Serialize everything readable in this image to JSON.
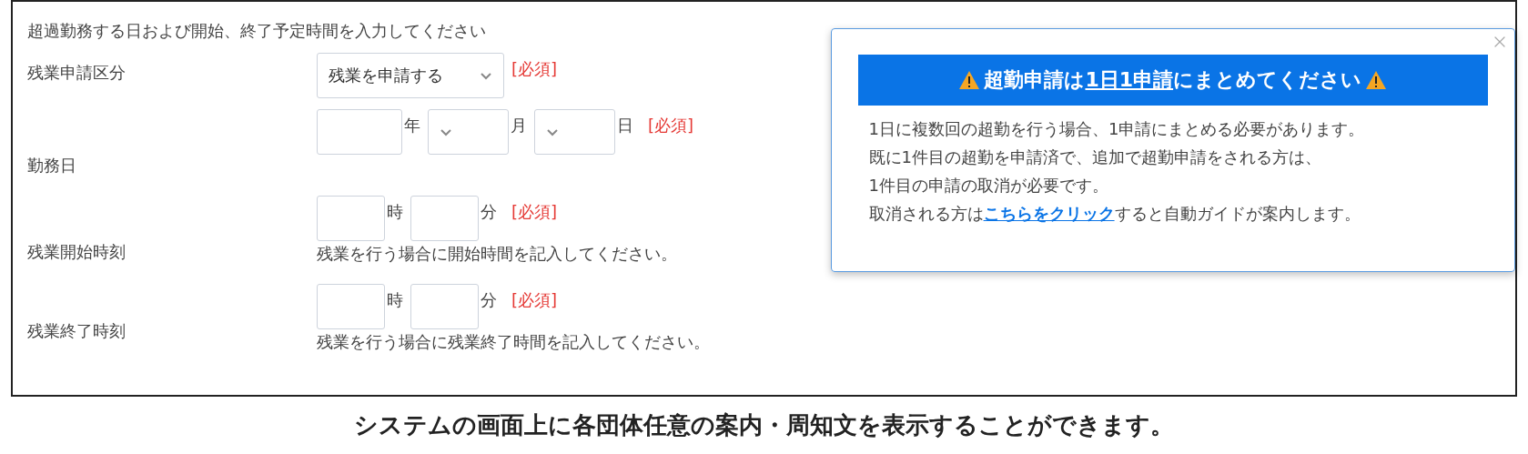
{
  "form": {
    "instruction": "超過勤務する日および開始、終了予定時間を入力してください",
    "fields": [
      {
        "label": "残業申請区分",
        "required": "[必須]",
        "controls": [
          {
            "kind": "dropdown",
            "value": "残業を申請する"
          }
        ]
      },
      {
        "label": "勤務日",
        "required": "[必須]",
        "controls": [
          {
            "kind": "text",
            "unit": "年"
          },
          {
            "kind": "dropdown",
            "unit": "月"
          },
          {
            "kind": "dropdown",
            "unit": "日"
          }
        ]
      },
      {
        "label": "残業開始時刻",
        "required": "[必須]",
        "hint": "残業を行う場合に開始時間を記入してください。",
        "controls": [
          {
            "kind": "short",
            "unit": "時"
          },
          {
            "kind": "short",
            "unit": "分"
          }
        ]
      },
      {
        "label": "残業終了時刻",
        "required": "[必須]",
        "hint": "残業を行う場合に残業終了時間を記入してください。",
        "controls": [
          {
            "kind": "short",
            "unit": "時"
          },
          {
            "kind": "short",
            "unit": "分"
          }
        ]
      }
    ]
  },
  "notice": {
    "heading": {
      "before": "超勤申請は",
      "underlined": "1日1申請",
      "after": "にまとめてください"
    },
    "lines": [
      "1日に複数回の超勤を行う場合、1申請にまとめる必要があります。",
      "既に1件目の超勤を申請済で、追加で超勤申請をされる方は、",
      "1件目の申請の取消が必要です。"
    ],
    "link_line": {
      "before": "取消される方は",
      "link": "こちらをクリック",
      "after": "すると自動ガイドが案内します。"
    }
  },
  "caption": "システムの画面上に各団体任意の案内・周知文を表示することができます。"
}
